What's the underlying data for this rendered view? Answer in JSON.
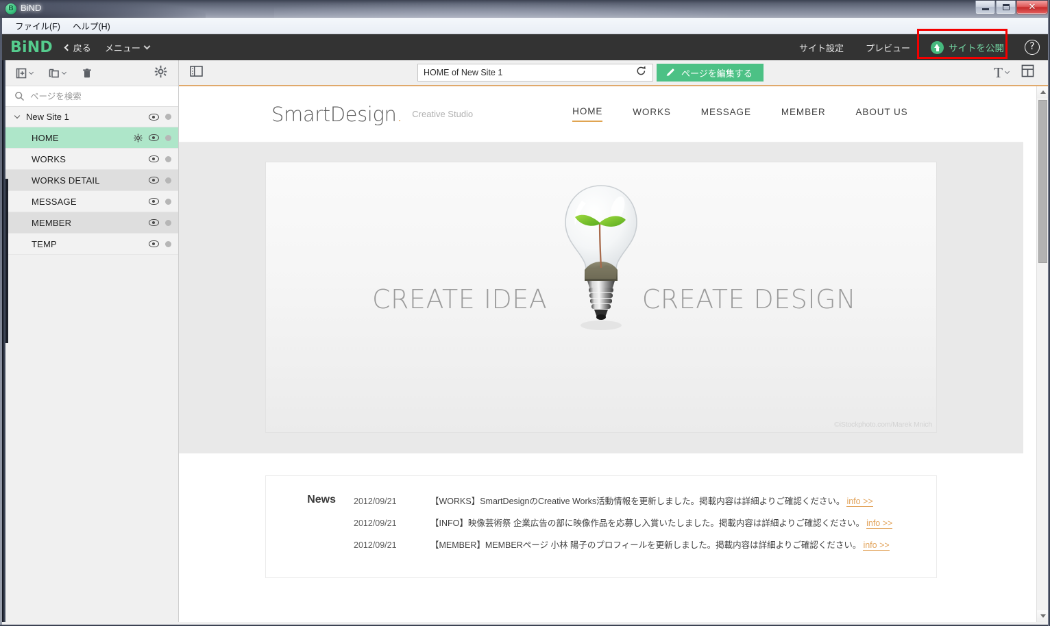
{
  "window": {
    "title": "BiND",
    "app_icon": "bind-app-icon",
    "minimize_label": "Minimize",
    "maximize_label": "Maximize",
    "close_label": "Close"
  },
  "menubar": {
    "items": [
      {
        "label": "ファイル(F)",
        "name": "menu-file"
      },
      {
        "label": "ヘルプ(H)",
        "name": "menu-help"
      }
    ]
  },
  "app_header": {
    "brand": "BiND",
    "back_label": "戻る",
    "menu_label": "メニュー",
    "site_settings_label": "サイト設定",
    "preview_label": "プレビュー",
    "publish_label": "サイトを公開",
    "help_label": "?",
    "brand_color": "#55cc8d",
    "publish_color": "#72d4a2",
    "highlight_color": "#f40000",
    "background": "#333333"
  },
  "sidebar": {
    "toolbar": [
      {
        "name": "add-page-button",
        "icon": "add-page-icon",
        "has_caret": true
      },
      {
        "name": "duplicate-page-button",
        "icon": "duplicate-page-icon",
        "has_caret": true
      },
      {
        "name": "delete-page-button",
        "icon": "trash-icon",
        "has_caret": false
      },
      {
        "name": "sidebar-settings-button",
        "icon": "gear-icon",
        "has_caret": false
      }
    ],
    "search": {
      "placeholder": "ページを検索",
      "value": "",
      "icon": "search-icon"
    },
    "site": {
      "name": "New Site 1",
      "expanded": true
    },
    "pages": [
      {
        "label": "HOME",
        "selected": true,
        "has_gear": true,
        "stripe": "odd"
      },
      {
        "label": "WORKS",
        "selected": false,
        "has_gear": false,
        "stripe": "odd"
      },
      {
        "label": "WORKS DETAIL",
        "selected": false,
        "has_gear": false,
        "stripe": "even"
      },
      {
        "label": "MESSAGE",
        "selected": false,
        "has_gear": false,
        "stripe": "odd"
      },
      {
        "label": "MEMBER",
        "selected": false,
        "has_gear": false,
        "stripe": "even"
      },
      {
        "label": "TEMP",
        "selected": false,
        "has_gear": false,
        "stripe": "odd"
      }
    ],
    "selected_color": "#aee6c9"
  },
  "main_toolbar": {
    "panel_toggle_icon": "panel-layout-icon",
    "url_value": "HOME of New Site 1",
    "reload_icon": "reload-icon",
    "edit_page_label": "ページを編集する",
    "edit_page_icon": "pencil-icon",
    "edit_button_color": "#4cc185",
    "text_tool_label": "T",
    "grid_tool_icon": "grid-layout-icon",
    "accent_underline": "#e0a96b"
  },
  "site_preview": {
    "logo": "SmartDesign",
    "logo_dot": ".",
    "tagline": "Creative Studio",
    "nav": [
      {
        "label": "HOME",
        "active": true
      },
      {
        "label": "WORKS",
        "active": false
      },
      {
        "label": "MESSAGE",
        "active": false
      },
      {
        "label": "MEMBER",
        "active": false
      },
      {
        "label": "ABOUT US",
        "active": false
      }
    ],
    "hero": {
      "left_text": "CREATE IDEA",
      "right_text": "CREATE DESIGN",
      "image_alt": "lightbulb-with-sprout",
      "credit": "©iStockphoto.com/Marek Mnich"
    },
    "news": {
      "title": "News",
      "link_label": "info >>",
      "items": [
        {
          "date": "2012/09/21",
          "text": "【WORKS】SmartDesignのCreative Works活動情報を更新しました。掲載内容は詳細よりご確認ください。",
          "link": "info >>"
        },
        {
          "date": "2012/09/21",
          "text": "【INFO】映像芸術祭 企業広告の部に映像作品を応募し入賞いたしました。掲載内容は詳細よりご確認ください。",
          "link": "info >>"
        },
        {
          "date": "2012/09/21",
          "text": "【MEMBER】MEMBERページ 小林 陽子のプロフィールを更新しました。掲載内容は詳細よりご確認ください。",
          "link": "info >>"
        }
      ]
    },
    "link_color": "#e2a45c",
    "accent_color": "#e8a04e"
  }
}
